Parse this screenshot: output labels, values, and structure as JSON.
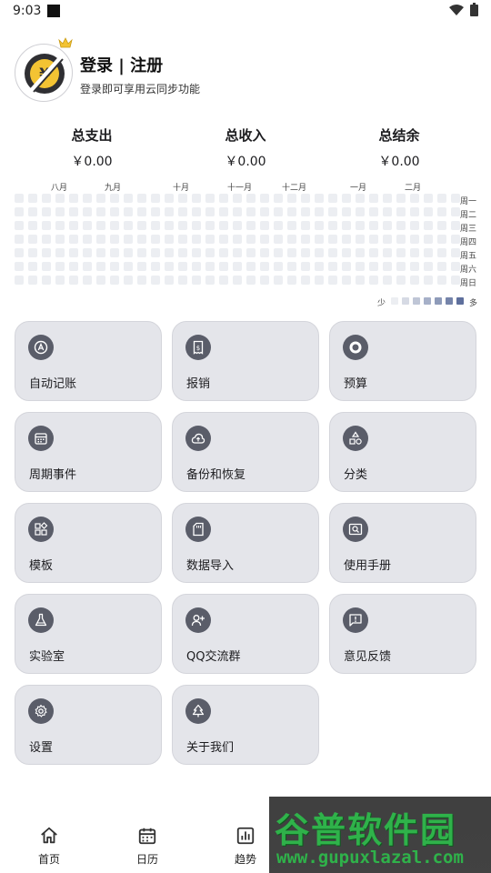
{
  "status_bar": {
    "time": "9:03"
  },
  "profile": {
    "title": "登录 | 注册",
    "subtitle": "登录即可享用云同步功能"
  },
  "summary": [
    {
      "label": "总支出",
      "value": "￥0.00"
    },
    {
      "label": "总收入",
      "value": "￥0.00"
    },
    {
      "label": "总结余",
      "value": "￥0.00"
    }
  ],
  "heatmap": {
    "months": [
      "八月",
      "九月",
      "十月",
      "十一月",
      "十二月",
      "一月",
      "二月"
    ],
    "days": [
      "周一",
      "周二",
      "周三",
      "周四",
      "周五",
      "周六",
      "周日"
    ],
    "legend_less": "少",
    "legend_more": "多",
    "legend_colors": [
      "#eceef2",
      "#d6dae4",
      "#bfc6d6",
      "#a6b0c8",
      "#8e9bb9",
      "#7584aa",
      "#5e6f9c"
    ],
    "empty_color": "#eceef2"
  },
  "cards": [
    {
      "label": "自动记账",
      "icon": "auto-a-icon"
    },
    {
      "label": "报销",
      "icon": "receipt-icon"
    },
    {
      "label": "预算",
      "icon": "budget-ring-icon"
    },
    {
      "label": "周期事件",
      "icon": "calendar-icon"
    },
    {
      "label": "备份和恢复",
      "icon": "cloud-upload-icon"
    },
    {
      "label": "分类",
      "icon": "category-shapes-icon"
    },
    {
      "label": "模板",
      "icon": "widgets-icon"
    },
    {
      "label": "数据导入",
      "icon": "sd-card-icon"
    },
    {
      "label": "使用手册",
      "icon": "manual-search-icon"
    },
    {
      "label": "实验室",
      "icon": "flask-icon"
    },
    {
      "label": "QQ交流群",
      "icon": "add-group-icon"
    },
    {
      "label": "意见反馈",
      "icon": "feedback-icon"
    },
    {
      "label": "设置",
      "icon": "gear-icon"
    },
    {
      "label": "关于我们",
      "icon": "tree-icon"
    }
  ],
  "bottom_nav": [
    {
      "label": "首页",
      "icon": "home-icon"
    },
    {
      "label": "日历",
      "icon": "calendar-icon"
    },
    {
      "label": "趋势",
      "icon": "bar-chart-icon"
    }
  ],
  "watermark": {
    "title": "谷普软件园",
    "url": "www.gupuxlazal.com"
  },
  "colors": {
    "card_bg": "#e4e5ea",
    "icon_bg": "#5a5d69",
    "avatar_yellow": "#f3c333"
  }
}
